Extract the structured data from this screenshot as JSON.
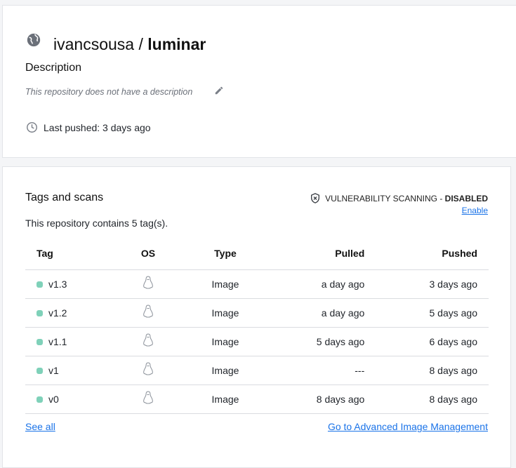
{
  "repo": {
    "owner": "ivancsousa",
    "separator": " / ",
    "name": "luminar",
    "description_heading": "Description",
    "description": "This repository does not have a description",
    "last_pushed": "Last pushed: 3 days ago"
  },
  "tags": {
    "heading": "Tags and scans",
    "count_text": "This repository contains 5 tag(s).",
    "vuln_label": "VULNERABILITY SCANNING - ",
    "vuln_status": "DISABLED",
    "enable": "Enable",
    "columns": [
      "Tag",
      "OS",
      "Type",
      "Pulled",
      "Pushed"
    ],
    "rows": [
      {
        "tag": "v1.3",
        "type": "Image",
        "pulled": "a day ago",
        "pushed": "3 days ago"
      },
      {
        "tag": "v1.2",
        "type": "Image",
        "pulled": "a day ago",
        "pushed": "5 days ago"
      },
      {
        "tag": "v1.1",
        "type": "Image",
        "pulled": "5 days ago",
        "pushed": "6 days ago"
      },
      {
        "tag": "v1",
        "type": "Image",
        "pulled": "---",
        "pushed": "8 days ago"
      },
      {
        "tag": "v0",
        "type": "Image",
        "pulled": "8 days ago",
        "pushed": "8 days ago"
      }
    ],
    "see_all": "See all",
    "advanced": "Go to Advanced Image Management"
  }
}
